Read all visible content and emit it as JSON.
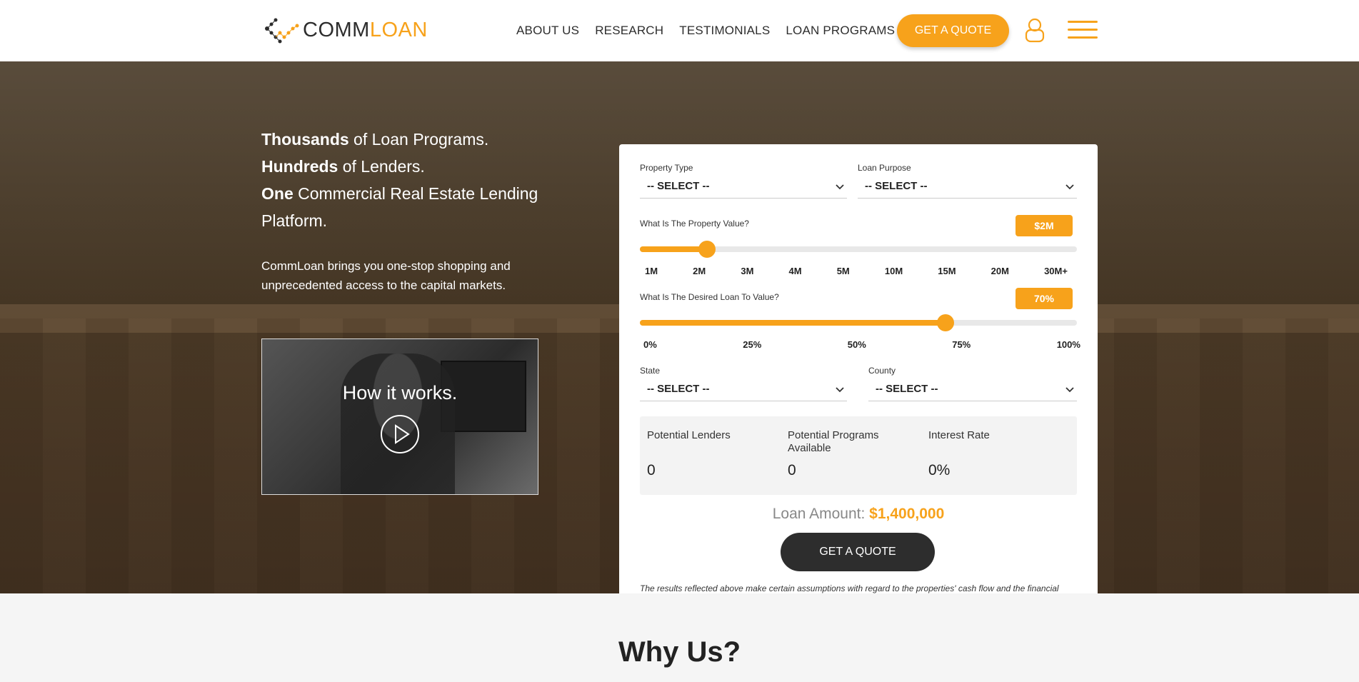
{
  "brand": {
    "logo_comm": "COMM",
    "logo_loan": "LOAN",
    "accent_color": "#f7a21b",
    "dark_color": "#2d2d2d"
  },
  "nav": {
    "items": [
      "ABOUT US",
      "RESEARCH",
      "TESTIMONIALS",
      "LOAN PROGRAMS"
    ],
    "quote_label": "GET A QUOTE",
    "user_icon": "user-icon",
    "menu_icon": "hamburger-menu-icon"
  },
  "hero": {
    "line1_bold": "Thousands",
    "line1_rest": " of Loan Programs.",
    "line2_bold": "Hundreds",
    "line2_rest": " of Lenders.",
    "line3_bold": "One",
    "line3_rest": " Commercial Real Estate Lending Platform.",
    "subtext": "CommLoan brings you one-stop shopping and unprecedented access to the capital markets.",
    "video_caption": "How it works.",
    "play_icon": "play-icon"
  },
  "form": {
    "property_type_label": "Property Type",
    "property_type_value": "-- SELECT --",
    "loan_purpose_label": "Loan Purpose",
    "loan_purpose_value": "-- SELECT --",
    "property_value_label": "What Is The Property Value?",
    "property_value_badge": "$2M",
    "property_value_ticks": [
      "1M",
      "2M",
      "3M",
      "4M",
      "5M",
      "10M",
      "15M",
      "20M",
      "30M+"
    ],
    "property_value_index": 1,
    "ltv_label": "What Is The Desired Loan To Value?",
    "ltv_badge": "70%",
    "ltv_ticks": [
      "0%",
      "25%",
      "50%",
      "75%",
      "100%"
    ],
    "ltv_percent": 70,
    "state_label": "State",
    "state_value": "-- SELECT --",
    "county_label": "County",
    "county_value": "-- SELECT --",
    "stats": {
      "lenders_label": "Potential Lenders",
      "lenders_value": "0",
      "programs_label": "Potential Programs Available",
      "programs_value": "0",
      "rate_label": "Interest Rate",
      "rate_value": "0%"
    },
    "loan_amount_label": "Loan Amount:",
    "loan_amount_value": "$1,400,000",
    "quote_label": "GET A QUOTE",
    "disclaimer": "The results reflected above make certain assumptions with regard to the properties' cash flow and the financial strength of the sponsor and a 5 year fixed rate period. The results are not a guarantee to lend and are an average of loans on the CUPID platform."
  },
  "why": {
    "title": "Why Us?"
  }
}
